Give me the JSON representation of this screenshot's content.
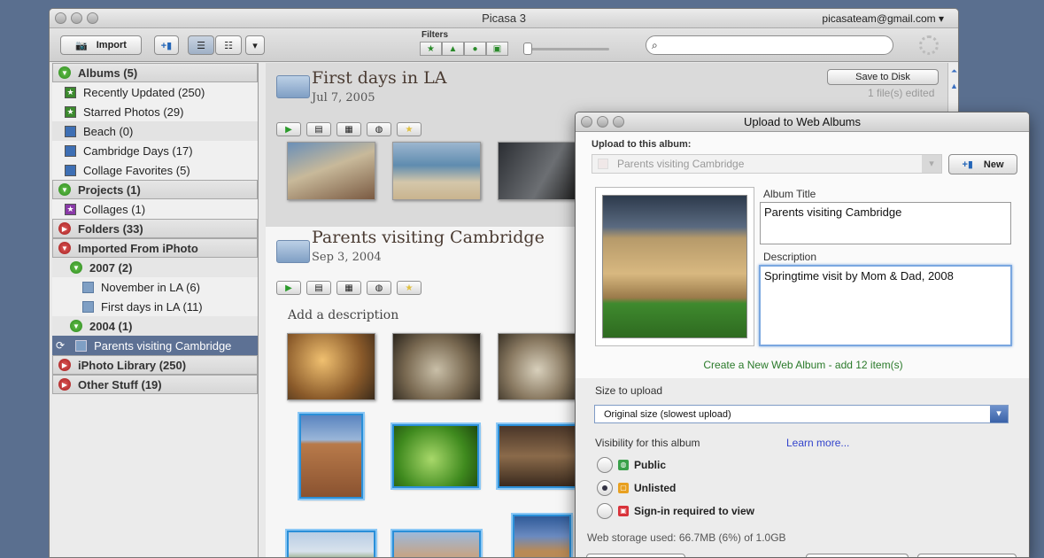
{
  "window": {
    "title": "Picasa 3",
    "account": "picasateam@gmail.com"
  },
  "toolbar": {
    "import_label": "Import",
    "filters_label": "Filters",
    "search_placeholder": ""
  },
  "sidebar": {
    "albums": "Albums (5)",
    "album_items": [
      "Recently Updated (250)",
      "Starred Photos (29)",
      "Beach (0)",
      "Cambridge Days (17)",
      "Collage Favorites (5)"
    ],
    "projects": "Projects (1)",
    "collages": "Collages (1)",
    "folders": "Folders (33)",
    "imported": "Imported From iPhoto",
    "year2007": "2007 (2)",
    "folders2007": [
      "November in LA (6)",
      "First days in LA (11)"
    ],
    "year2004": "2004 (1)",
    "selected": "Parents visiting Cambridge",
    "iphoto": "iPhoto Library (250)",
    "other": "Other Stuff (19)"
  },
  "main": {
    "section1": {
      "title": "First days in LA",
      "date": "Jul 7, 2005",
      "save_label": "Save to Disk",
      "edited": "1 file(s) edited"
    },
    "section2": {
      "title": "Parents visiting Cambridge",
      "date": "Sep 3, 2004",
      "description_placeholder": "Add a description"
    }
  },
  "dialog": {
    "title": "Upload to Web Albums",
    "upload_to_label": "Upload to this album:",
    "album_select": "Parents visiting Cambridge",
    "new_label": "New",
    "album_title_label": "Album Title",
    "album_title_value": "Parents visiting Cambridge",
    "description_label": "Description",
    "description_value": "Springtime visit by Mom & Dad, 2008",
    "create_text": "Create a New Web Album - add 12 item(s)",
    "size_label": "Size to upload",
    "size_value": "Original size (slowest upload)",
    "visibility_label": "Visibility for this album",
    "learn_more": "Learn more...",
    "options": [
      "Public",
      "Unlisted",
      "Sign-in required to view"
    ],
    "selected_option": "Unlisted",
    "storage": "Web storage used: 66.7MB (6%) of 1.0GB"
  },
  "colors": {
    "accent": "#2a8fd8",
    "selection": "#5d7194",
    "link": "#3344cc",
    "create_green": "#2a7a2a"
  }
}
